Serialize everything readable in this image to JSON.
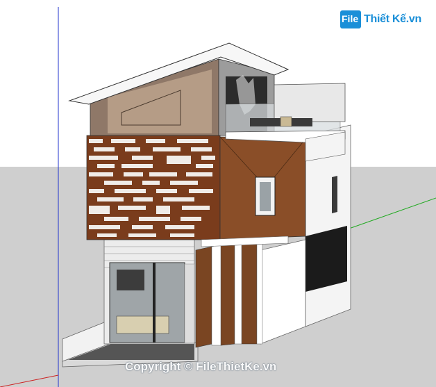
{
  "logo": {
    "mark": "File",
    "name": "Thiết Kế.vn"
  },
  "watermark": "Copyright © FileThietKe.vn",
  "colors": {
    "sky": "#ffffff",
    "ground": "#c8c8c8",
    "wood": "#6b3a1f",
    "brick_light": "#e6e6e6",
    "glass": "#9a9a9a",
    "accent_blue": "#1a8fd8",
    "axis_red": "#cc2222",
    "axis_green": "#22aa22",
    "axis_blue": "#2233cc"
  }
}
